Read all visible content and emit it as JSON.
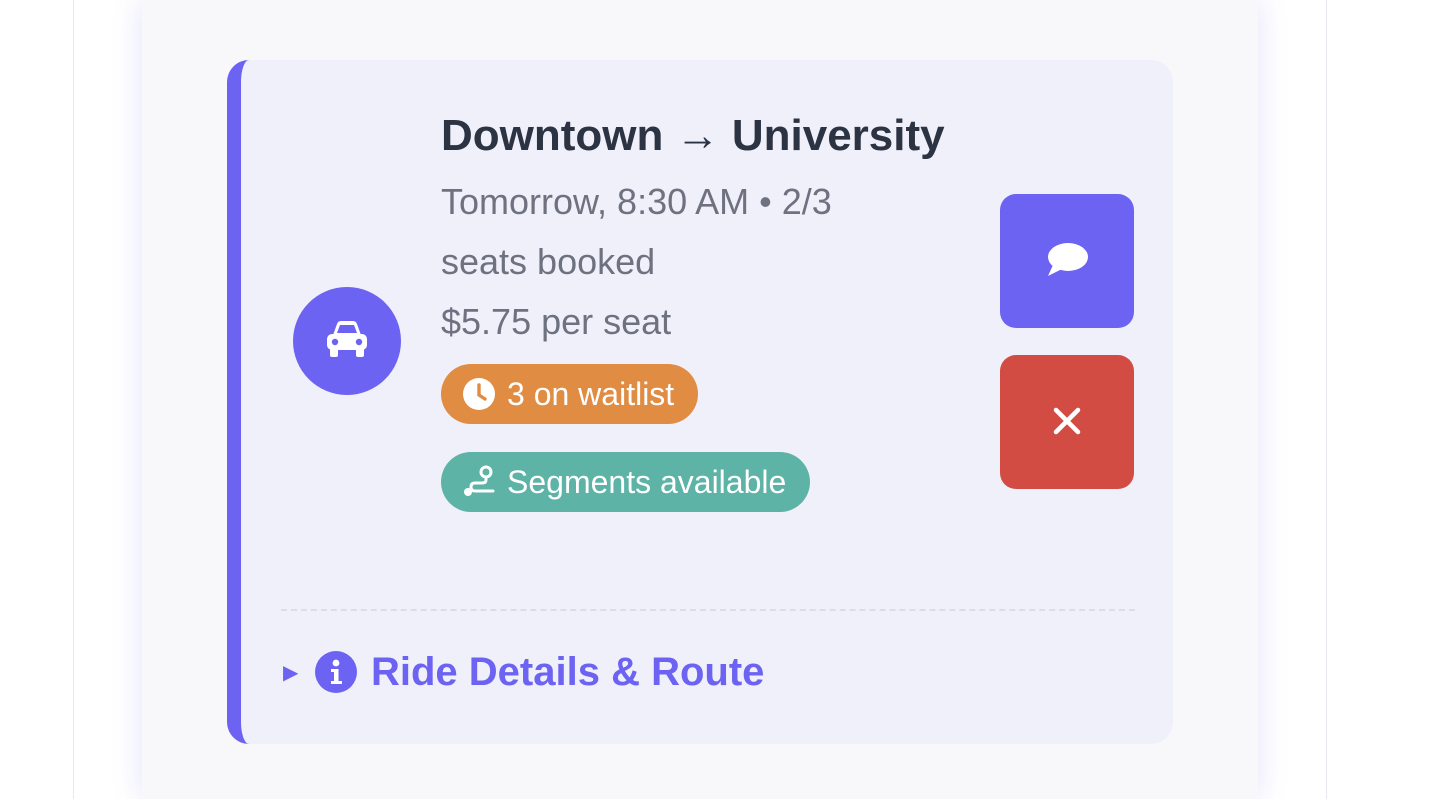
{
  "ride": {
    "route_from": "Downtown",
    "route_arrow": "→",
    "route_to": "University",
    "time_and_seats": "Tomorrow, 8:30 AM • 2/3",
    "seats_suffix": "seats booked",
    "price": "$5.75 per seat",
    "waitlist_badge": "3 on waitlist",
    "segments_badge": "Segments available",
    "details_link": "Ride Details & Route"
  },
  "icons": {
    "avatar": "car-icon",
    "waitlist": "clock-icon",
    "segments": "route-icon",
    "chat": "comment-icon",
    "cancel": "close-icon",
    "details_caret": "caret-right-icon",
    "details_info": "info-icon"
  },
  "colors": {
    "accent": "#6c63f2",
    "danger": "#d24c44",
    "waitlist": "#e08c43",
    "segments": "#5cb3a6",
    "card_bg": "#f0f0fa",
    "title_text": "#2c3342",
    "muted_text": "#6e7280"
  }
}
